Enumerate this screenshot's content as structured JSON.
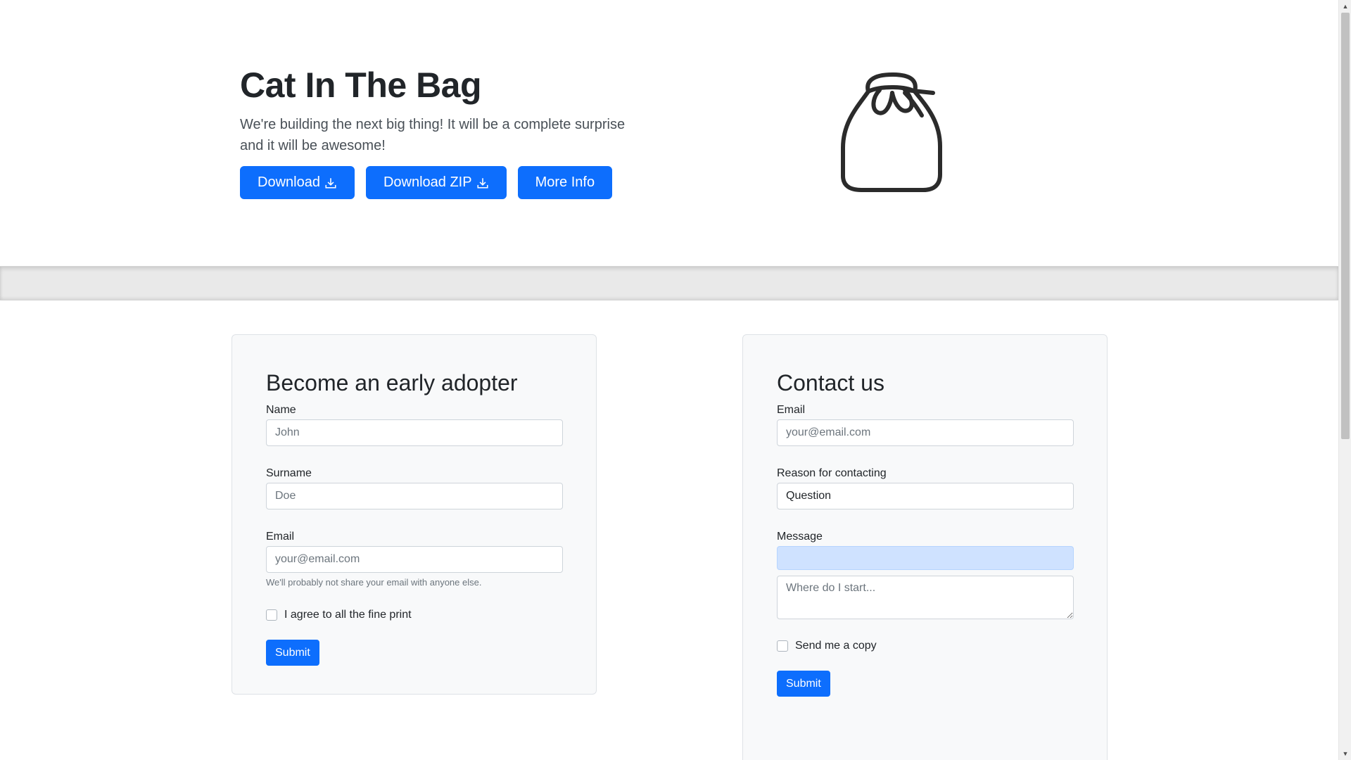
{
  "hero": {
    "title": "Cat In The Bag",
    "lead": "We're building the next big thing! It will be a complete surprise and it will be awesome!",
    "buttons": {
      "download": "Download",
      "download_zip": "Download ZIP",
      "more_info": "More Info"
    },
    "logo_icon": "bag-icon"
  },
  "early_adopter": {
    "title": "Become an early adopter",
    "name_label": "Name",
    "name_placeholder": "John",
    "surname_label": "Surname",
    "surname_placeholder": "Doe",
    "email_label": "Email",
    "email_placeholder": "your@email.com",
    "email_help": "We'll probably not share your email with anyone else.",
    "agree_label": "I agree to all the fine print",
    "submit_label": "Submit"
  },
  "contact": {
    "title": "Contact us",
    "email_label": "Email",
    "email_placeholder": "your@email.com",
    "reason_label": "Reason for contacting",
    "reason_value": "Question",
    "message_label": "Message",
    "message_placeholder": "Where do I start...",
    "copy_label": "Send me a copy",
    "submit_label": "Submit"
  },
  "colors": {
    "primary": "#0d6efd",
    "card_bg": "#f8f9fa",
    "highlight": "#cfe2ff",
    "band": "#e9e9e9"
  }
}
